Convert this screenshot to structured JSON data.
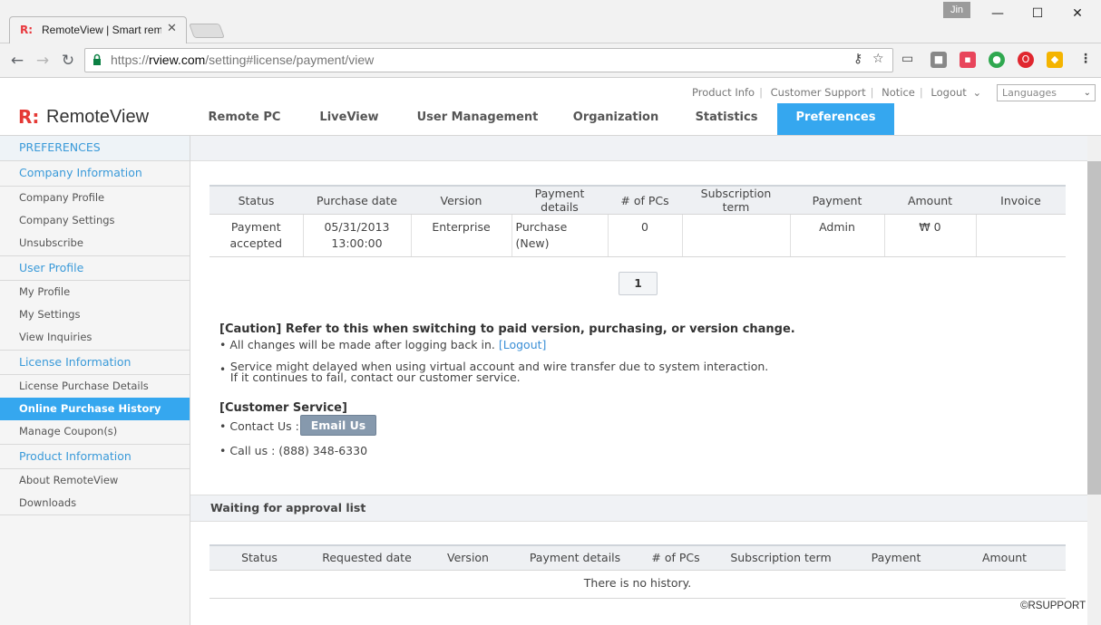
{
  "browser": {
    "tab_title": "RemoteView | Smart rem",
    "tab_favicon": "R:",
    "profile_name": "Jin",
    "url_scheme": "https://",
    "url_host": "rview.com",
    "url_path": "/setting#license/payment/view",
    "icons": [
      "back-icon",
      "forward-icon",
      "reload-icon",
      "lock-icon",
      "key-icon",
      "star-icon",
      "cast-icon",
      "menu-icon"
    ]
  },
  "header": {
    "util_links": [
      "Product Info",
      "Customer Support",
      "Notice",
      "Logout"
    ],
    "language_select": "Languages",
    "logo_mark": "R:",
    "logo_text": "RemoteView",
    "nav": [
      "Remote PC",
      "LiveView",
      "User Management",
      "Organization",
      "Statistics",
      "Preferences"
    ],
    "active_nav": "Preferences",
    "accent_color": "#35a7ef"
  },
  "sidebar": {
    "title": "PREFERENCES",
    "groups": [
      {
        "label": "Company Information",
        "items": [
          "Company Profile",
          "Company Settings",
          "Unsubscribe"
        ]
      },
      {
        "label": "User Profile",
        "items": [
          "My Profile",
          "My Settings",
          "View Inquiries"
        ]
      },
      {
        "label": "License Information",
        "items": [
          "License Purchase Details",
          "Online Purchase History",
          "Manage Coupon(s)"
        ]
      },
      {
        "label": "Product Information",
        "items": [
          "About RemoteView",
          "Downloads"
        ]
      }
    ],
    "active_item": "Online Purchase History"
  },
  "purchase_table": {
    "headers": [
      "Status",
      "Purchase date",
      "Version",
      "Payment details",
      "# of PCs",
      "Subscription term",
      "Payment",
      "Amount",
      "Invoice"
    ],
    "rows": [
      {
        "status_line1": "Payment",
        "status_line2": "accepted",
        "date_line1": "05/31/2013",
        "date_line2": "13:00:00",
        "version": "Enterprise",
        "details": "Purchase (New)",
        "pcs": "0",
        "term": "",
        "payment": "Admin",
        "amount": "₩ 0",
        "invoice": ""
      }
    ]
  },
  "pagination": {
    "current": "1"
  },
  "caution": {
    "title": "[Caution] Refer to this when switching to paid version, purchasing, or version change.",
    "line1": "All changes will be made after logging back in.",
    "logout_link": "[Logout]",
    "line2a": "Service might delayed when using virtual account and wire transfer due to system interaction.",
    "line2b": "If it continues to fail, contact our customer service."
  },
  "customer_service": {
    "title": "[Customer Service]",
    "contact_label": "Contact Us :",
    "email_button": "Email Us",
    "call_line": "Call us : (888) 348-6330"
  },
  "approval": {
    "title": "Waiting for approval list",
    "headers": [
      "Status",
      "Requested date",
      "Version",
      "Payment details",
      "# of PCs",
      "Subscription term",
      "Payment",
      "Amount"
    ],
    "empty_text": "There is no history."
  },
  "footer": {
    "copyright": "©RSUPPORT"
  }
}
